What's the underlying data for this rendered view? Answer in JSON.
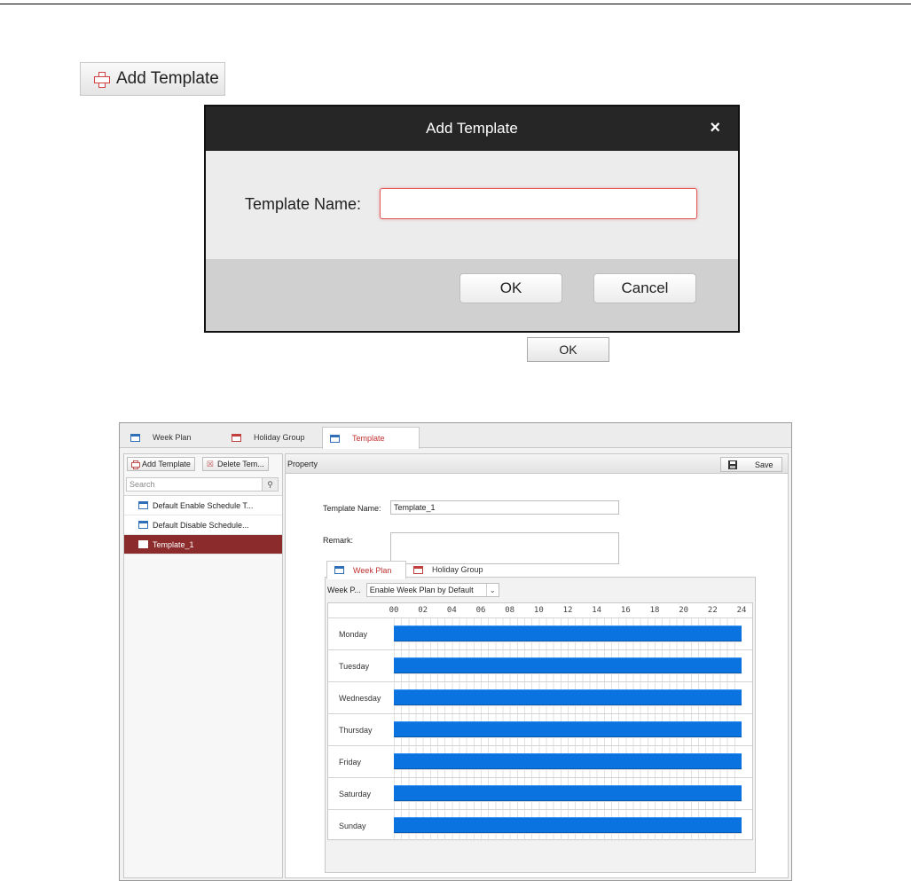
{
  "doc": {
    "add_template_button": "Add Template"
  },
  "dialog": {
    "title": "Add Template",
    "close_glyph": "×",
    "name_label": "Template Name:",
    "name_value": "",
    "ok_label": "OK",
    "cancel_label": "Cancel"
  },
  "small_ok_label": "OK",
  "app": {
    "tabs": [
      {
        "label": "Week Plan",
        "icon": "calendar-icon"
      },
      {
        "label": "Holiday Group",
        "icon": "holiday-calendar-icon"
      },
      {
        "label": "Template",
        "icon": "template-icon",
        "active": true
      }
    ],
    "left": {
      "add_label": "Add Template",
      "delete_label": "Delete Tem...",
      "search_placeholder": "Search",
      "items": [
        {
          "label": "Default Enable Schedule T..."
        },
        {
          "label": "Default Disable Schedule..."
        },
        {
          "label": "Template_1",
          "selected": true
        }
      ]
    },
    "right": {
      "header": "Property",
      "save_label": "Save",
      "template_name_label": "Template Name:",
      "template_name_value": "Template_1",
      "remark_label": "Remark:",
      "remark_value": "",
      "subtabs": [
        {
          "label": "Week Plan",
          "active": true
        },
        {
          "label": "Holiday Group"
        }
      ],
      "week_plan_label": "Week P...",
      "week_plan_select": "Enable Week Plan by Default",
      "hours": [
        "00",
        "02",
        "04",
        "06",
        "08",
        "10",
        "12",
        "14",
        "16",
        "18",
        "20",
        "22",
        "24"
      ],
      "days": [
        {
          "name": "Monday",
          "start": 0,
          "end": 24
        },
        {
          "name": "Tuesday",
          "start": 0,
          "end": 24
        },
        {
          "name": "Wednesday",
          "start": 0,
          "end": 24
        },
        {
          "name": "Thursday",
          "start": 0,
          "end": 24
        },
        {
          "name": "Friday",
          "start": 0,
          "end": 24
        },
        {
          "name": "Saturday",
          "start": 0,
          "end": 24
        },
        {
          "name": "Sunday",
          "start": 0,
          "end": 24
        }
      ],
      "bar_color": "#0a73e0"
    }
  }
}
